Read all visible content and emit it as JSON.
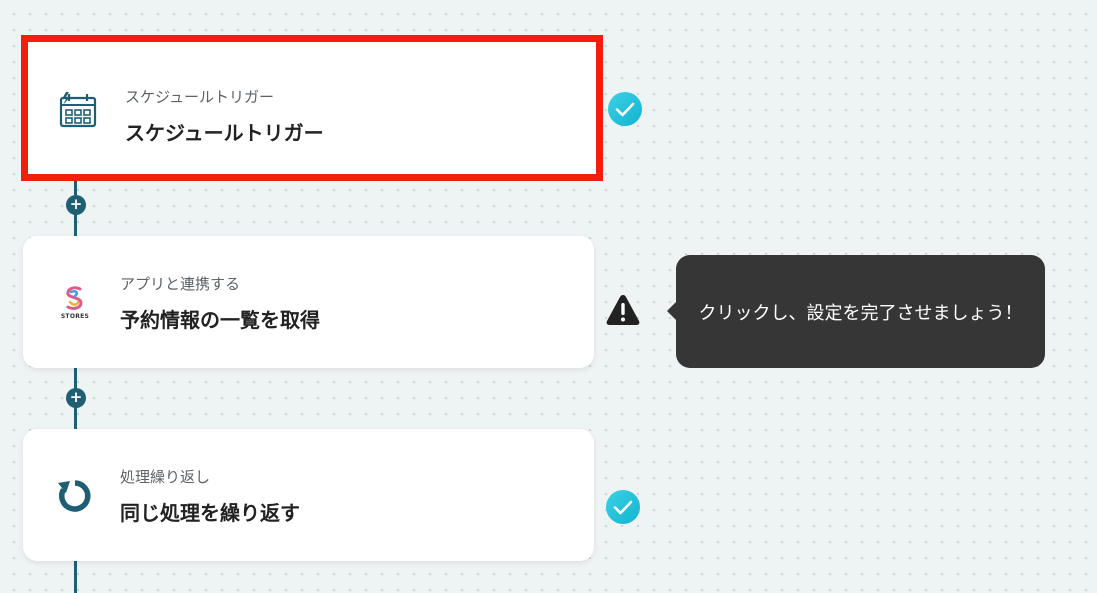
{
  "steps": [
    {
      "sub": "スケジュールトリガー",
      "title": "スケジュールトリガー",
      "icon": "calendar-schedule-icon",
      "status": "complete",
      "selected": true
    },
    {
      "sub": "アプリと連携する",
      "title": "予約情報の一覧を取得",
      "icon": "stores-logo",
      "logo_text": "STORES",
      "status": "warning"
    },
    {
      "sub": "処理繰り返し",
      "title": "同じ処理を繰り返す",
      "icon": "loop-icon",
      "status": "complete"
    }
  ],
  "tooltip": {
    "text": "クリックし、設定を完了させましょう！"
  },
  "add_button_glyph": "+",
  "colors": {
    "highlight": "#f21d0a",
    "connector": "#1f5f74",
    "check": "#21c4dd",
    "warning": "#222222",
    "tooltip_bg": "#363636"
  }
}
